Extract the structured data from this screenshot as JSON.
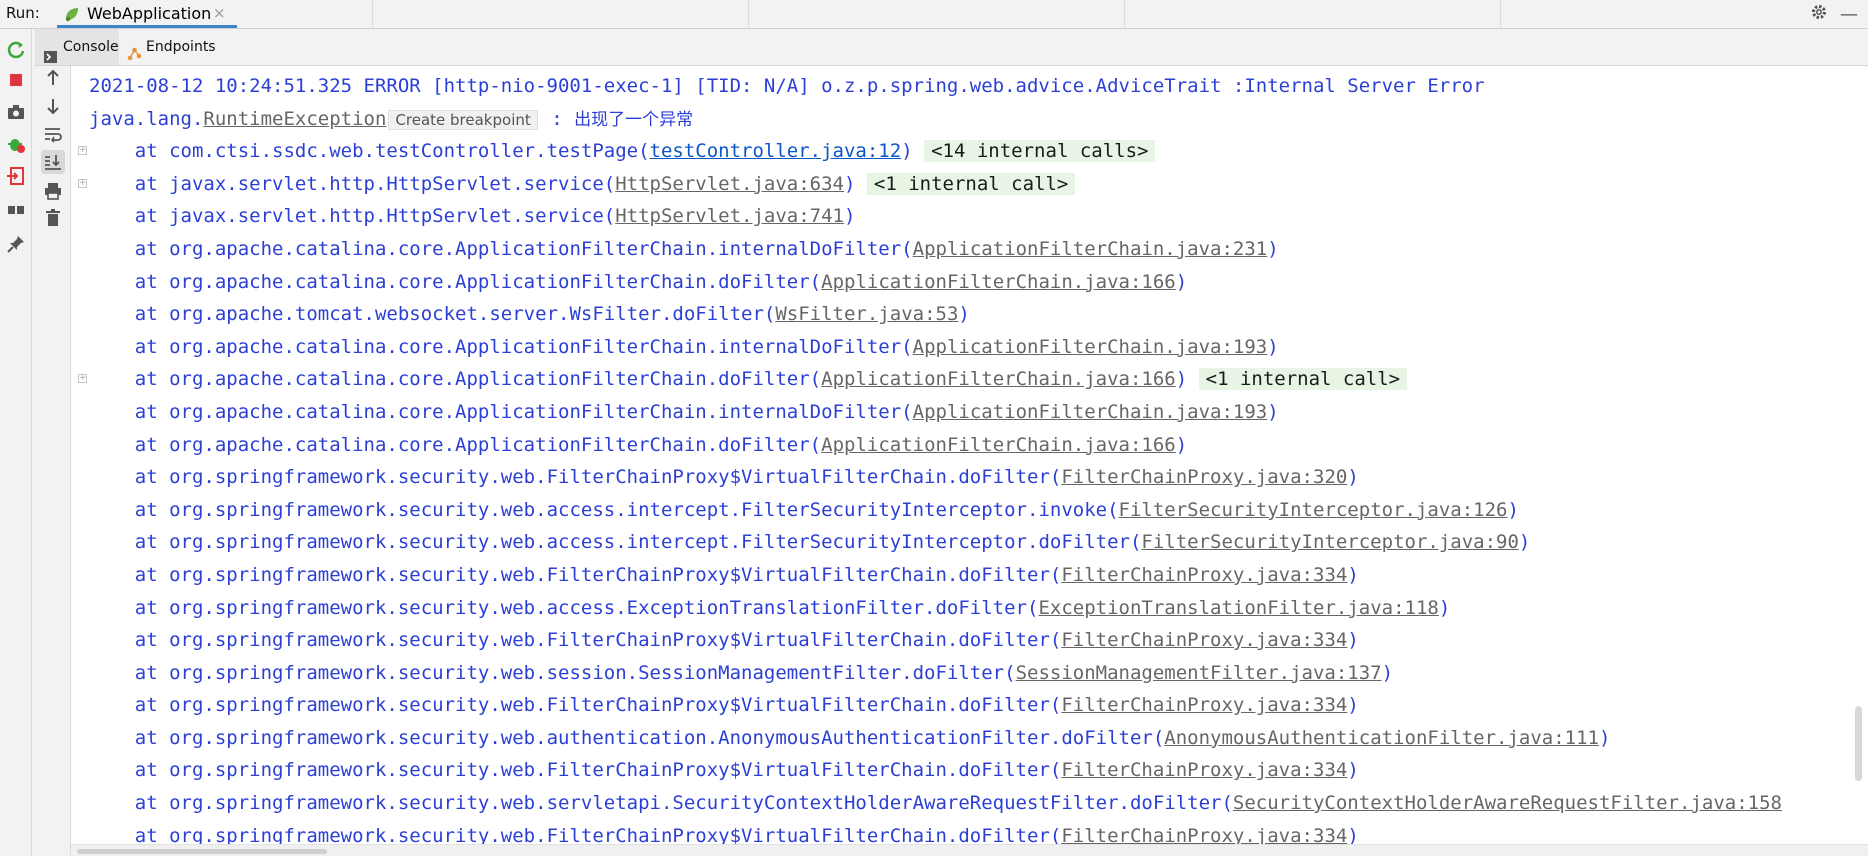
{
  "runbar": {
    "label": "Run:",
    "tab_title": "WebApplication",
    "tab_close": "×"
  },
  "subtabs": [
    {
      "label": "Console"
    },
    {
      "label": "Endpoints"
    }
  ],
  "console": {
    "error_header": "2021-08-12 10:24:51.325 ERROR [http-nio-9001-exec-1] [TID: N/A] o.z.p.spring.web.advice.AdviceTrait :Internal Server Error",
    "exception_prefix": "java.lang.",
    "exception_class": "RuntimeException",
    "create_breakpoint": "Create breakpoint",
    "exception_message_sep": " : ",
    "exception_message": "出现了一个异常",
    "frames": [
      {
        "method": "com.ctsi.ssdc.web.testController.testPage",
        "source": "testController.java:12",
        "internal": "<14 internal calls>",
        "hot": true,
        "fold": true
      },
      {
        "method": "javax.servlet.http.HttpServlet.service",
        "source": "HttpServlet.java:634",
        "internal": "<1 internal call>",
        "fold": true
      },
      {
        "method": "javax.servlet.http.HttpServlet.service",
        "source": "HttpServlet.java:741"
      },
      {
        "method": "org.apache.catalina.core.ApplicationFilterChain.internalDoFilter",
        "source": "ApplicationFilterChain.java:231"
      },
      {
        "method": "org.apache.catalina.core.ApplicationFilterChain.doFilter",
        "source": "ApplicationFilterChain.java:166"
      },
      {
        "method": "org.apache.tomcat.websocket.server.WsFilter.doFilter",
        "source": "WsFilter.java:53"
      },
      {
        "method": "org.apache.catalina.core.ApplicationFilterChain.internalDoFilter",
        "source": "ApplicationFilterChain.java:193"
      },
      {
        "method": "org.apache.catalina.core.ApplicationFilterChain.doFilter",
        "source": "ApplicationFilterChain.java:166",
        "internal": "<1 internal call>",
        "fold": true
      },
      {
        "method": "org.apache.catalina.core.ApplicationFilterChain.internalDoFilter",
        "source": "ApplicationFilterChain.java:193"
      },
      {
        "method": "org.apache.catalina.core.ApplicationFilterChain.doFilter",
        "source": "ApplicationFilterChain.java:166"
      },
      {
        "method": "org.springframework.security.web.FilterChainProxy$VirtualFilterChain.doFilter",
        "source": "FilterChainProxy.java:320"
      },
      {
        "method": "org.springframework.security.web.access.intercept.FilterSecurityInterceptor.invoke",
        "source": "FilterSecurityInterceptor.java:126"
      },
      {
        "method": "org.springframework.security.web.access.intercept.FilterSecurityInterceptor.doFilter",
        "source": "FilterSecurityInterceptor.java:90"
      },
      {
        "method": "org.springframework.security.web.FilterChainProxy$VirtualFilterChain.doFilter",
        "source": "FilterChainProxy.java:334"
      },
      {
        "method": "org.springframework.security.web.access.ExceptionTranslationFilter.doFilter",
        "source": "ExceptionTranslationFilter.java:118"
      },
      {
        "method": "org.springframework.security.web.FilterChainProxy$VirtualFilterChain.doFilter",
        "source": "FilterChainProxy.java:334"
      },
      {
        "method": "org.springframework.security.web.session.SessionManagementFilter.doFilter",
        "source": "SessionManagementFilter.java:137"
      },
      {
        "method": "org.springframework.security.web.FilterChainProxy$VirtualFilterChain.doFilter",
        "source": "FilterChainProxy.java:334"
      },
      {
        "method": "org.springframework.security.web.authentication.AnonymousAuthenticationFilter.doFilter",
        "source": "AnonymousAuthenticationFilter.java:111"
      },
      {
        "method": "org.springframework.security.web.FilterChainProxy$VirtualFilterChain.doFilter",
        "source": "FilterChainProxy.java:334"
      },
      {
        "method": "org.springframework.security.web.servletapi.SecurityContextHolderAwareRequestFilter.doFilter",
        "source": "SecurityContextHolderAwareRequestFilter.java:158",
        "truncated": true
      },
      {
        "method": "org.springframework.security.web.FilterChainProxy$VirtualFilterChain.doFilter",
        "source": "FilterChainProxy.java:334"
      }
    ]
  },
  "colors": {
    "accent": "#4083c9",
    "stack_text": "#2b3fd6",
    "internal_bg": "#e9f5e4",
    "rerun": "#3aa83a",
    "stop": "#e0353a"
  }
}
